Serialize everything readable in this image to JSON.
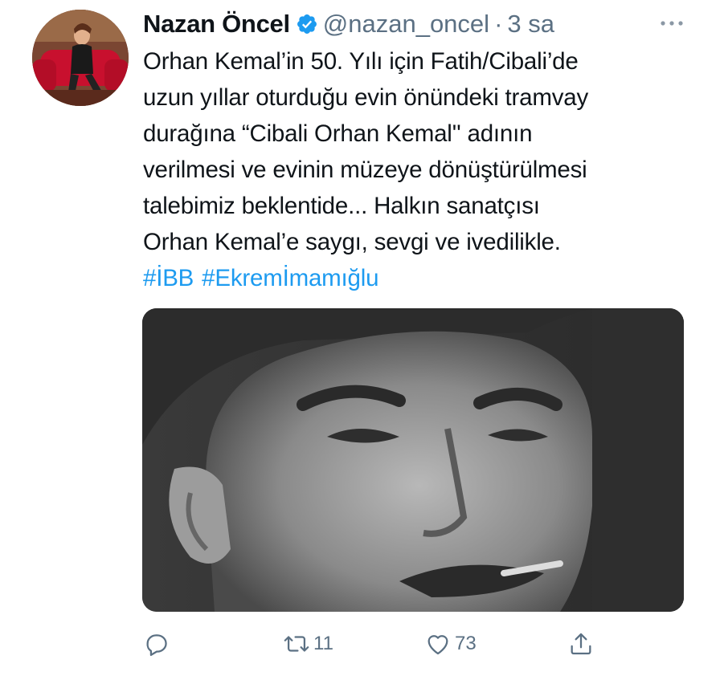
{
  "tweet": {
    "author": {
      "name": "Nazan Öncel",
      "handle": "@nazan_oncel",
      "verified": true,
      "avatar_icon": "profile-photo-woman-on-red-couch"
    },
    "separator": "·",
    "time": "3 sa",
    "text_lines": [
      "Orhan Kemal’in 50. Yılı için Fatih/Cibali’de",
      "uzun yıllar oturduğu evin önündeki tramvay",
      "durağına “Cibali Orhan Kemal'' adının",
      "verilmesi ve evinin müzeye dönüştürülmesi",
      "talebimiz beklentide... Halkın sanatçısı",
      "Orhan Kemal’e saygı, sevgi ve ivedilikle."
    ],
    "hashtags": [
      "#İBB",
      "#Ekremİmamığlu"
    ],
    "media": {
      "type": "photo",
      "description_icon": "black-and-white-portrait-photo"
    },
    "actions": {
      "reply_count": "",
      "retweet_count": "11",
      "like_count": "73"
    }
  },
  "colors": {
    "text": "#0f1419",
    "secondary": "#5b7083",
    "link": "#1d9bf0",
    "verified": "#1d9bf0"
  }
}
